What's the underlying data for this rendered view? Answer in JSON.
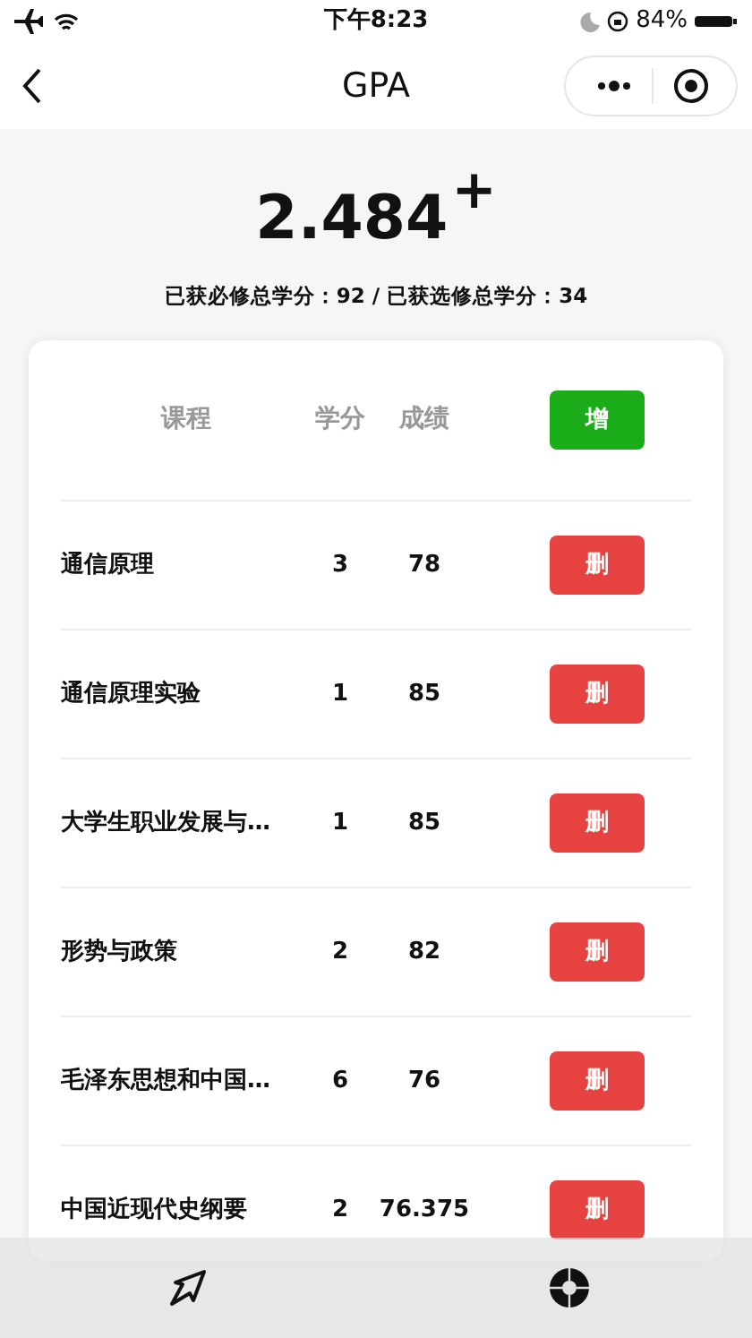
{
  "status_bar": {
    "time": "下午8:23",
    "battery": "84%"
  },
  "nav": {
    "title": "GPA"
  },
  "gpa": {
    "value": "2.484",
    "mark": "+"
  },
  "credits_summary": "已获必修总学分：92 / 已获选修总学分：34",
  "table": {
    "columns": [
      "课程",
      "学分",
      "成绩"
    ],
    "add_button": "增",
    "rows": [
      {
        "course": "通信原理",
        "credits": "3",
        "score": "78",
        "action": "删"
      },
      {
        "course": "通信原理实验",
        "credits": "1",
        "score": "85",
        "action": "删"
      },
      {
        "course": "大学生职业发展与…",
        "credits": "1",
        "score": "85",
        "action": "删"
      },
      {
        "course": "形势与政策",
        "credits": "2",
        "score": "82",
        "action": "删"
      },
      {
        "course": "毛泽东思想和中国…",
        "credits": "6",
        "score": "76",
        "action": "删"
      },
      {
        "course": "中国近现代史纲要",
        "credits": "2",
        "score": "76.375",
        "action": "删"
      }
    ]
  }
}
